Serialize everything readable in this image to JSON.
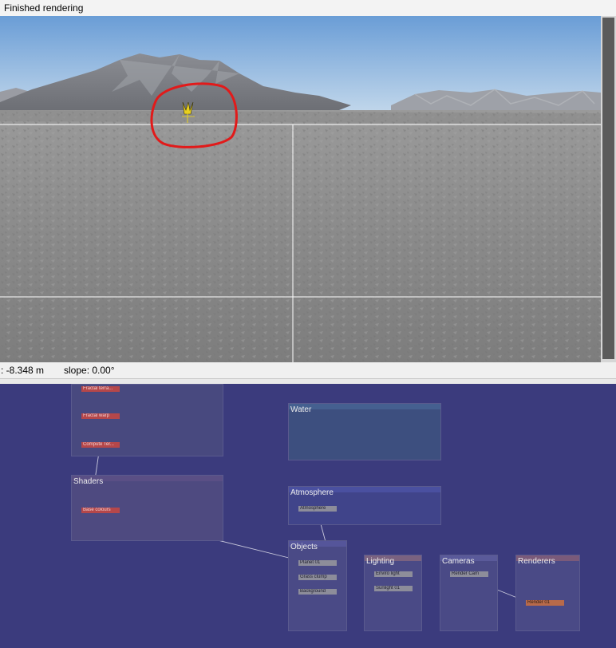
{
  "title_bar": {
    "text": "Finished rendering"
  },
  "status_bar": {
    "altitude": ": -8.348 m",
    "slope": "slope: 0.00°"
  },
  "colors": {
    "sky_top": "#6d9fd6",
    "sky_bottom": "#c9dcec",
    "ground": "#8f8f8f",
    "graph_bg": "#3b3b7d",
    "annotation": "#e21a1a",
    "marker": "#e8d020"
  },
  "node_graph": {
    "groups": {
      "terrain": {
        "label": "",
        "nodes": [
          "Fractal terra...",
          "Fractal warp",
          "Compute Ter..."
        ]
      },
      "shaders": {
        "label": "Shaders",
        "nodes": [
          "Base colours"
        ]
      },
      "water": {
        "label": "Water",
        "nodes": []
      },
      "atmosphere": {
        "label": "Atmosphere",
        "nodes": [
          "Atmosphere"
        ]
      },
      "objects": {
        "label": "Objects",
        "nodes": [
          "Planet 01",
          "Grass clump",
          "Background"
        ]
      },
      "lighting": {
        "label": "Lighting",
        "nodes": [
          "Enviro light",
          "Sunlight 01"
        ]
      },
      "cameras": {
        "label": "Cameras",
        "nodes": [
          "Render Cam"
        ]
      },
      "renderers": {
        "label": "Renderers",
        "nodes": [
          "Render 01"
        ]
      }
    }
  }
}
